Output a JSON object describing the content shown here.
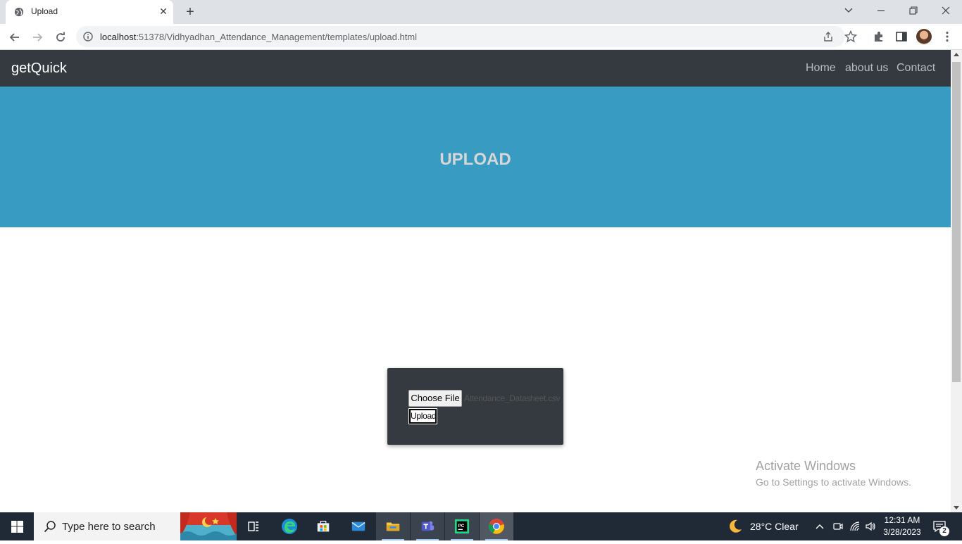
{
  "browser": {
    "tab_title": "Upload",
    "url_host": "localhost",
    "url_path": ":51378/Vidhyadhan_Attendance_Management/templates/upload.html"
  },
  "navbar": {
    "brand": "getQuick",
    "links": [
      "Home",
      "about us",
      "Contact"
    ]
  },
  "hero": {
    "title": "UPLOAD"
  },
  "upload_form": {
    "choose_label": "Choose File",
    "file_name": "Attendance_Datasheet.csv",
    "upload_label": "Upload"
  },
  "watermark": {
    "line1": "Activate Windows",
    "line2": "Go to Settings to activate Windows."
  },
  "taskbar": {
    "search_placeholder": "Type here to search",
    "weather": "28°C  Clear",
    "time": "12:31 AM",
    "date": "3/28/2023",
    "notification_count": "2"
  },
  "colors": {
    "navbar_bg": "#343a40",
    "hero_bg": "#389bc2",
    "taskbar_bg": "#202a37"
  }
}
